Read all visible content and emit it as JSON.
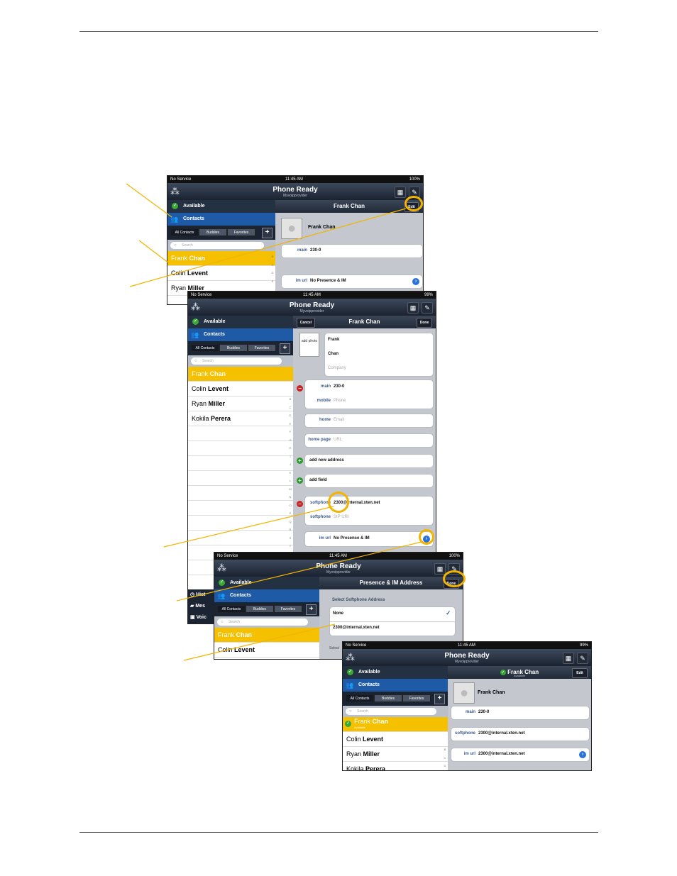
{
  "status": {
    "carrier": "No Service",
    "time": "11:45 AM",
    "battery1": "100%",
    "battery2": "99%"
  },
  "app": {
    "title": "Phone Ready",
    "subtitle": "Myvoipprovider"
  },
  "sidebar": {
    "availability": "Available",
    "section": "Contacts",
    "tabs": [
      "All Contacts",
      "Buddies",
      "Favorites"
    ],
    "add": "+",
    "search_placeholder": "Search",
    "contacts": [
      {
        "first": "Frank ",
        "last": "Chan"
      },
      {
        "first": "Colin ",
        "last": "Levent"
      },
      {
        "first": "Ryan ",
        "last": "Miller"
      },
      {
        "first": "Kokila ",
        "last": "Perera"
      }
    ],
    "index_letters": [
      "B",
      "C",
      "D",
      "E",
      "F",
      "G",
      "H",
      "I",
      "J",
      "K",
      "L",
      "M",
      "N",
      "O",
      "P",
      "Q",
      "R",
      "S",
      "T",
      "U"
    ],
    "bottom_tabs": [
      "Hist",
      "Mes",
      "Voic"
    ]
  },
  "screen1": {
    "header": "Frank Chan",
    "edit": "Edit",
    "name": "Frank Chan",
    "main_label": "main",
    "main_value": "230-0",
    "im_label": "im url",
    "im_value": "No Presence & IM"
  },
  "screen2": {
    "cancel": "Cancel",
    "header": "Frank Chan",
    "done": "Done",
    "add_photo": "add photo",
    "first": "Frank",
    "last": "Chan",
    "company": "Company",
    "main_label": "main",
    "main_value": "230-0",
    "mobile_label": "mobile",
    "mobile_ph": "Phone",
    "home_label": "home",
    "home_ph": "Email",
    "homepage_label": "home page",
    "homepage_ph": "URL",
    "add_address": "add new address",
    "add_field": "add field",
    "softphone_label": "softphone",
    "softphone_value": "2300@internal.xten.net",
    "softphone2_label": "softphone",
    "softphone2_ph": "SIP URI",
    "im_label": "im url",
    "im_value": "No Presence & IM"
  },
  "screen3": {
    "header": "Presence & IM Address",
    "done": "Done",
    "section": "Select Softphone Address",
    "options": [
      "None",
      "2300@internal.xten.net"
    ],
    "check": "✓",
    "footer": "Select"
  },
  "screen4": {
    "header": "Frank Chan",
    "header_sub": "Available",
    "edit": "Edit",
    "name": "Frank Chan",
    "selected_sub": "Available",
    "main_label": "main",
    "main_value": "230-0",
    "softphone_label": "softphone",
    "softphone_value": "2300@internal.xten.net",
    "im_label": "im url",
    "im_value": "2300@internal.xten.net"
  },
  "colors": {
    "accent": "#f5c000",
    "callout": "#f2b400",
    "nav": "#1e5aa6"
  }
}
